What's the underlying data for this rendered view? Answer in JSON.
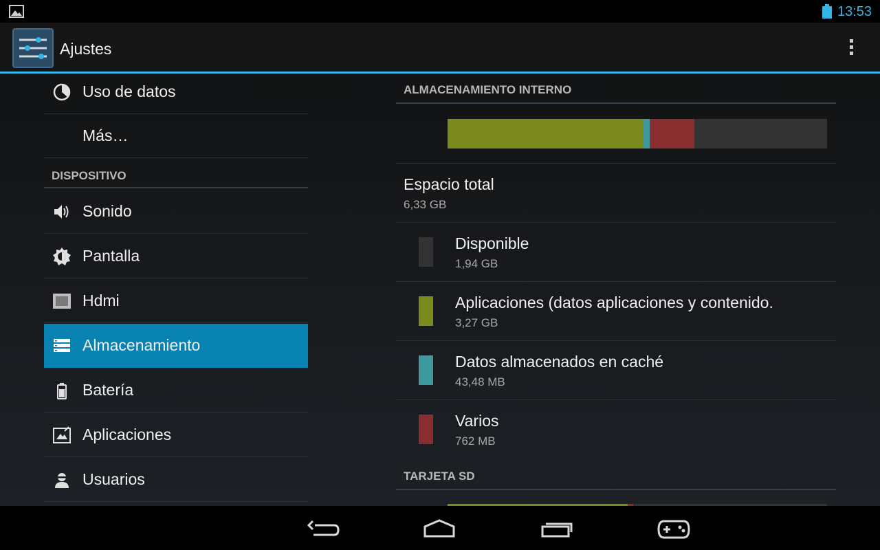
{
  "status_bar": {
    "time": "13:53",
    "notification_icon": "image-icon",
    "battery_icon": "battery-icon",
    "accent_color": "#33b5e5"
  },
  "action_bar": {
    "app_icon": "settings-sliders-icon",
    "title": "Ajustes",
    "overflow_icon": "overflow-menu-icon"
  },
  "sidebar": {
    "items_top": [
      {
        "label": "Uso de datos",
        "icon": "data-usage-icon"
      },
      {
        "label": "Más…",
        "icon": ""
      }
    ],
    "section_device": "DISPOSITIVO",
    "items_device": [
      {
        "label": "Sonido",
        "icon": "speaker-icon"
      },
      {
        "label": "Pantalla",
        "icon": "brightness-icon"
      },
      {
        "label": "Hdmi",
        "icon": "hdmi-icon"
      },
      {
        "label": "Almacenamiento",
        "icon": "storage-icon",
        "selected": true
      },
      {
        "label": "Batería",
        "icon": "battery-icon"
      },
      {
        "label": "Aplicaciones",
        "icon": "apps-icon"
      },
      {
        "label": "Usuarios",
        "icon": "user-icon"
      }
    ],
    "selected_color": "#0882b0"
  },
  "storage": {
    "internal_header": "ALMACENAMIENTO INTERNO",
    "usage_bar": [
      {
        "key": "apps",
        "fraction": 0.517,
        "color": "#7b8a1c"
      },
      {
        "key": "cache",
        "fraction": 0.015,
        "color": "#3f9aa0"
      },
      {
        "key": "misc",
        "fraction": 0.118,
        "color": "#8a2e30"
      },
      {
        "key": "available",
        "fraction": 0.35,
        "color": "#333333"
      }
    ],
    "total": {
      "title": "Espacio total",
      "value": "6,33 GB"
    },
    "items": [
      {
        "title": "Disponible",
        "value": "1,94 GB",
        "color": "#333333"
      },
      {
        "title": "Aplicaciones (datos aplicaciones y contenido.",
        "value": "3,27 GB",
        "color": "#7b8a1c"
      },
      {
        "title": "Datos almacenados en caché",
        "value": "43,48 MB",
        "color": "#3f9aa0"
      },
      {
        "title": "Varios",
        "value": "762 MB",
        "color": "#8a2e30"
      }
    ],
    "sd_header": "TARJETA SD"
  },
  "nav_bar": {
    "back_icon": "back-icon",
    "home_icon": "home-icon",
    "recents_icon": "recents-icon",
    "game_icon": "gamepad-icon"
  }
}
